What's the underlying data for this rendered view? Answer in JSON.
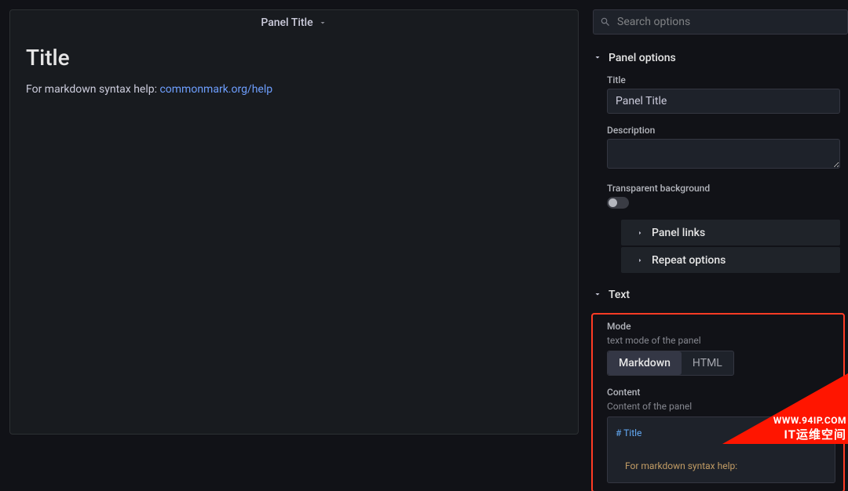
{
  "preview": {
    "panel_title": "Panel Title",
    "content_heading": "Title",
    "help_text": "For markdown syntax help: ",
    "help_link_label": "commonmark.org/help"
  },
  "sidebar": {
    "search_placeholder": "Search options",
    "panel_options": {
      "section_title": "Panel options",
      "title_label": "Title",
      "title_value": "Panel Title",
      "description_label": "Description",
      "description_value": "",
      "transparent_label": "Transparent background",
      "panel_links_label": "Panel links",
      "repeat_options_label": "Repeat options"
    },
    "text_section": {
      "section_title": "Text",
      "mode_label": "Mode",
      "mode_desc": "text mode of the panel",
      "mode_options": {
        "markdown": "Markdown",
        "html": "HTML"
      },
      "content_label": "Content",
      "content_desc": "Content of the panel",
      "content_code_line1": "# Title",
      "content_code_line2": "For markdown syntax help:"
    }
  },
  "watermark": {
    "line1": "WWW.94IP.COM",
    "line2": "IT运维空间"
  }
}
